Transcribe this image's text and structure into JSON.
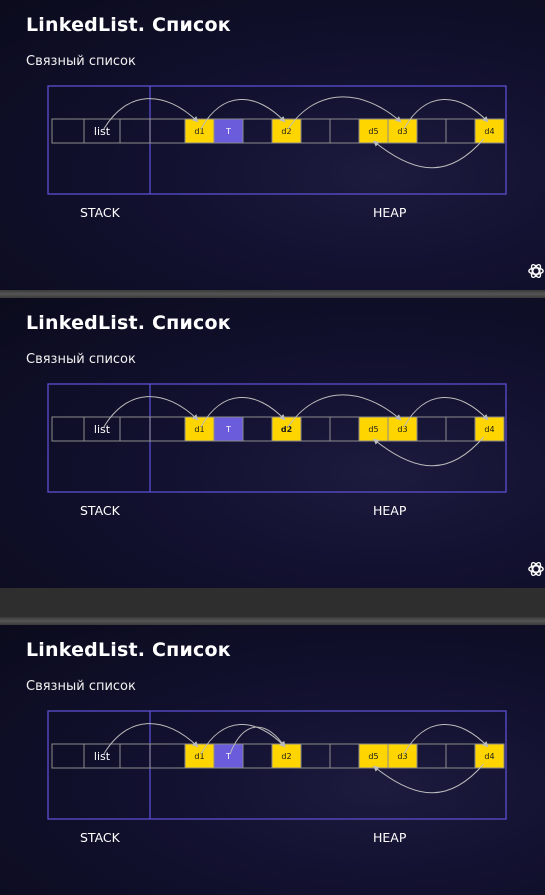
{
  "colors": {
    "memory_frame": "#5a4fcf",
    "cell_border": "#8c8c8c",
    "data_cell": "#ffd500",
    "tail_cell": "#6a5cdb",
    "arrow": "#bbbbbb",
    "text": "#ffffff"
  },
  "icons": {
    "logo": "openai-logo-icon"
  },
  "slides": [
    {
      "title": "LinkedList. Список",
      "subtitle": "Связный список",
      "stack_label": "STACK",
      "heap_label": "HEAP",
      "cells": [
        {
          "text": "",
          "kind": "empty"
        },
        {
          "text": "list",
          "kind": "variable"
        },
        {
          "text": "",
          "kind": "empty"
        },
        {
          "text": "",
          "kind": "empty"
        },
        {
          "text": "d1",
          "kind": "data"
        },
        {
          "text": "T",
          "kind": "tail"
        },
        {
          "text": "",
          "kind": "empty"
        },
        {
          "text": "d2",
          "kind": "data"
        },
        {
          "text": "",
          "kind": "empty"
        },
        {
          "text": "",
          "kind": "empty"
        },
        {
          "text": "d5",
          "kind": "data"
        },
        {
          "text": "d3",
          "kind": "data"
        },
        {
          "text": "",
          "kind": "empty"
        },
        {
          "text": "",
          "kind": "empty"
        },
        {
          "text": "d4",
          "kind": "data"
        }
      ],
      "links": [
        {
          "from": 1,
          "to": 4,
          "side": "top"
        },
        {
          "from": 4,
          "to": 7,
          "side": "top"
        },
        {
          "from": 7,
          "to": 11,
          "side": "top"
        },
        {
          "from": 11,
          "to": 14,
          "side": "top"
        },
        {
          "from": 14,
          "to": 10,
          "side": "bottom"
        }
      ]
    },
    {
      "title": "LinkedList. Список",
      "subtitle": "Связный список",
      "stack_label": "STACK",
      "heap_label": "HEAP",
      "cells": [
        {
          "text": "",
          "kind": "empty"
        },
        {
          "text": "list",
          "kind": "variable"
        },
        {
          "text": "",
          "kind": "empty"
        },
        {
          "text": "",
          "kind": "empty"
        },
        {
          "text": "d1",
          "kind": "data"
        },
        {
          "text": "T",
          "kind": "tail"
        },
        {
          "text": "",
          "kind": "empty"
        },
        {
          "text": "d2",
          "kind": "data",
          "bold": true
        },
        {
          "text": "",
          "kind": "empty"
        },
        {
          "text": "",
          "kind": "empty"
        },
        {
          "text": "d5",
          "kind": "data"
        },
        {
          "text": "d3",
          "kind": "data"
        },
        {
          "text": "",
          "kind": "empty"
        },
        {
          "text": "",
          "kind": "empty"
        },
        {
          "text": "d4",
          "kind": "data"
        }
      ],
      "links": [
        {
          "from": 1,
          "to": 4,
          "side": "top"
        },
        {
          "from": 4,
          "to": 7,
          "side": "top"
        },
        {
          "from": 7,
          "to": 11,
          "side": "top"
        },
        {
          "from": 11,
          "to": 14,
          "side": "top"
        },
        {
          "from": 14,
          "to": 10,
          "side": "bottom"
        }
      ]
    },
    {
      "title": "LinkedList. Список",
      "subtitle": "Связный список",
      "stack_label": "STACK",
      "heap_label": "HEAP",
      "cells": [
        {
          "text": "",
          "kind": "empty"
        },
        {
          "text": "list",
          "kind": "variable"
        },
        {
          "text": "",
          "kind": "empty"
        },
        {
          "text": "",
          "kind": "empty"
        },
        {
          "text": "d1",
          "kind": "data"
        },
        {
          "text": "T",
          "kind": "tail"
        },
        {
          "text": "",
          "kind": "empty"
        },
        {
          "text": "d2",
          "kind": "data"
        },
        {
          "text": "",
          "kind": "empty"
        },
        {
          "text": "",
          "kind": "empty"
        },
        {
          "text": "d5",
          "kind": "data"
        },
        {
          "text": "d3",
          "kind": "data"
        },
        {
          "text": "",
          "kind": "empty"
        },
        {
          "text": "",
          "kind": "empty"
        },
        {
          "text": "d4",
          "kind": "data"
        }
      ],
      "links": [
        {
          "from": 1,
          "to": 4,
          "side": "top"
        },
        {
          "from": 4,
          "to": 7,
          "side": "top"
        },
        {
          "from": 5,
          "to": 7,
          "side": "top"
        },
        {
          "from": 11,
          "to": 14,
          "side": "top"
        },
        {
          "from": 14,
          "to": 10,
          "side": "bottom"
        }
      ]
    }
  ]
}
